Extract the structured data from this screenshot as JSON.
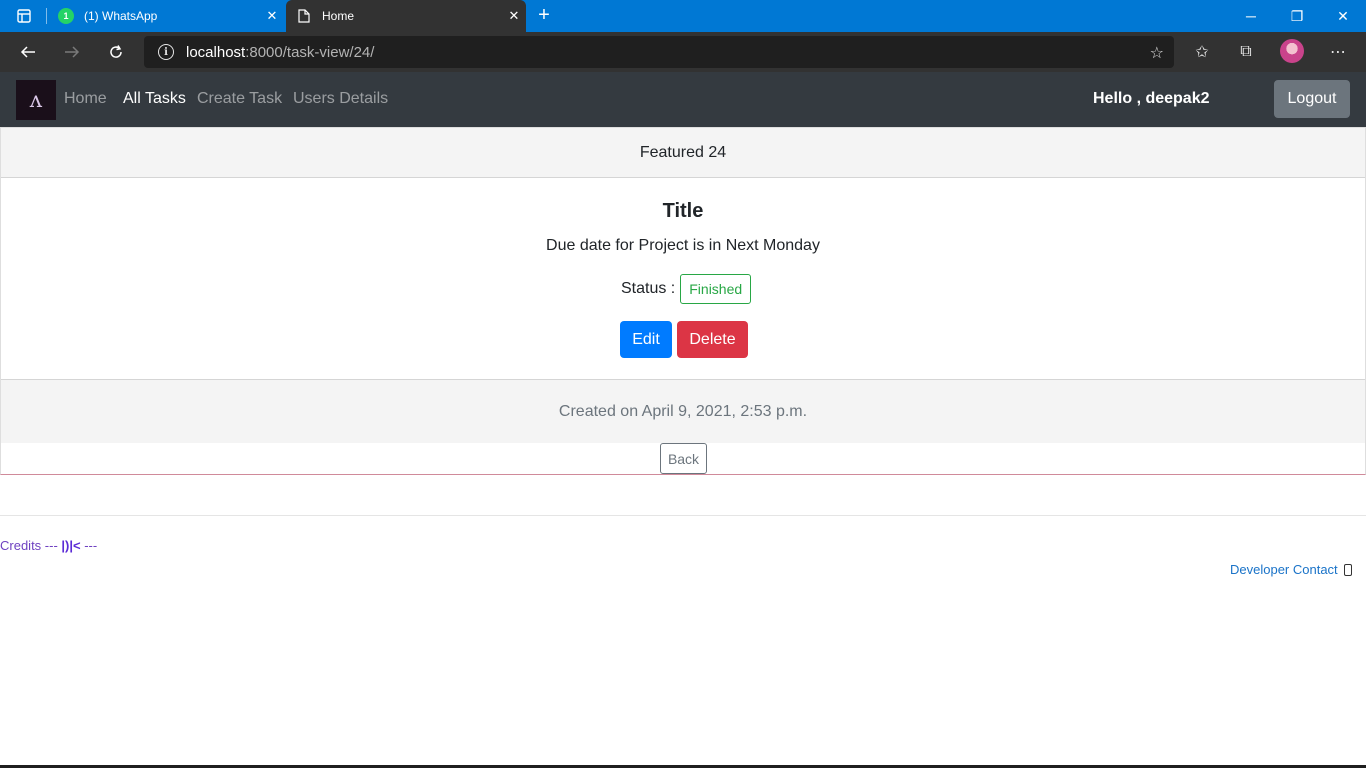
{
  "browser": {
    "tabs": [
      {
        "title": "(1) WhatsApp",
        "badge": "1"
      },
      {
        "title": "Home",
        "active": true
      }
    ],
    "url": {
      "host": "localhost",
      "rest": ":8000/task-view/24/"
    },
    "icons": {
      "tab_actions": "tab-actions-icon",
      "new_tab": "+",
      "minimize": "─",
      "restore": "❐",
      "close": "✕",
      "back": "←",
      "forward": "→",
      "reload": "↻",
      "favorite_add": "☆",
      "favorites": "✩",
      "collections": "⧉",
      "more": "⋯",
      "info": "i"
    }
  },
  "navbar": {
    "links": [
      "Home",
      "All Tasks",
      "Create Task",
      "Users Details"
    ],
    "greeting": "Hello , deepak2",
    "logout": "Logout",
    "logo_glyph": "ᴧ"
  },
  "card": {
    "header": "Featured 24",
    "title": "Title",
    "text": "Due date for Project is in Next Monday",
    "status_label": "Status :",
    "status_value": "Finished",
    "edit": "Edit",
    "delete": "Delete",
    "footer": "Created on April 9, 2021, 2:53 p.m.",
    "back": "Back"
  },
  "footer": {
    "credits_prefix": "Credits --- ",
    "credits_sig": "|)|<",
    "credits_suffix": " ---",
    "developer_contact": "Developer Contact"
  },
  "colors": {
    "browser_accent": "#0078d4",
    "navbar_bg": "#343a40",
    "primary": "#007bff",
    "danger": "#dc3545",
    "success": "#28a745",
    "secondary": "#6c757d"
  }
}
